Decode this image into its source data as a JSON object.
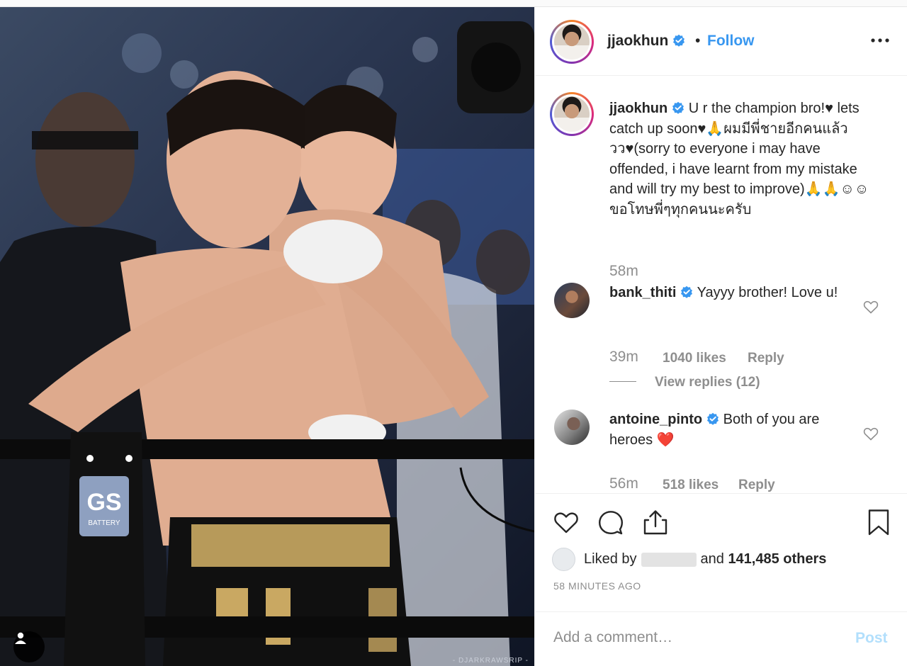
{
  "post": {
    "author": "jjaokhun",
    "follow_label": "Follow",
    "separator": "•",
    "more_icon": "more-horizontal-icon",
    "verified_color": "#3897f0"
  },
  "photo": {
    "watermark": "- DJARKRAWSRIP -",
    "user_tag_icon": "user-tag-icon",
    "ring_sponsor": "GS",
    "ring_sponsor_sub": "BATTERY"
  },
  "caption": {
    "username": "jjaokhun",
    "text": "U r the champion bro!♥ lets catch up soon♥🙏ผมมีพี่ชายอีกคนแล้ววว♥(sorry to everyone i may have offended, i have learnt from my mistake and will try my best to improve)🙏🙏☺☺ขอโทษพี่ๆทุกคนนะครับ",
    "time": "58m"
  },
  "comments": [
    {
      "username": "bank_thiti",
      "text": "Yayyy brother! Love u!",
      "time": "39m",
      "likes": "1040 likes",
      "reply_label": "Reply",
      "view_replies": "View replies (12)"
    },
    {
      "username": "antoine_pinto",
      "text": "Both of you are heroes ❤️",
      "time": "56m",
      "likes": "518 likes",
      "reply_label": "Reply"
    }
  ],
  "actions": {
    "like_icon": "heart-icon",
    "comment_icon": "comment-icon",
    "share_icon": "share-icon",
    "save_icon": "bookmark-icon",
    "liked_by_prefix": "Liked by",
    "liked_by_conjunction": "and",
    "liked_by_count": "141,485 others",
    "timestamp": "58 MINUTES AGO"
  },
  "add_comment": {
    "placeholder": "Add a comment…",
    "post_label": "Post"
  }
}
